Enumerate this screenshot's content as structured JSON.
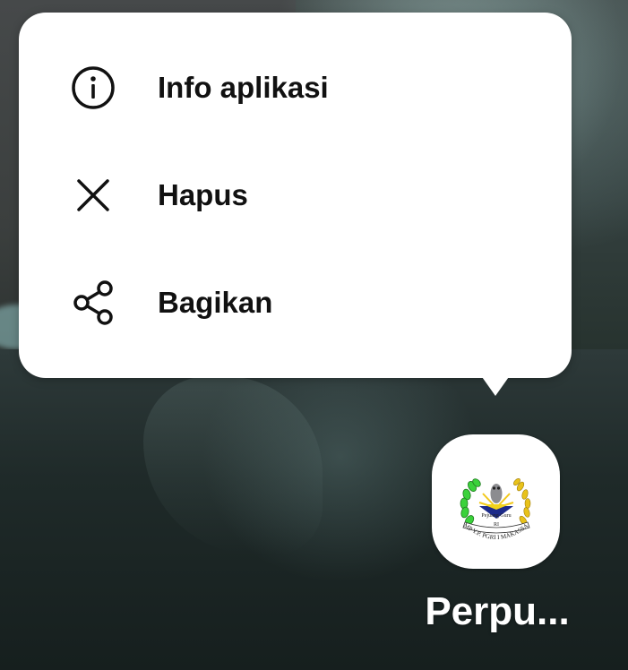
{
  "wallpaper": {
    "description_colors": {
      "sky": "#3f4746",
      "sea": "#1d2a2b"
    }
  },
  "context_menu": {
    "items": [
      {
        "label": "Info aplikasi",
        "icon": "info-icon"
      },
      {
        "label": "Hapus",
        "icon": "close-icon"
      },
      {
        "label": "Bagikan",
        "icon": "share-icon"
      }
    ],
    "background": "#ffffff",
    "text_color": "#111111"
  },
  "app": {
    "label": "Perpu...",
    "icon": "school-logo-icon",
    "logo_texts": {
      "banner": "Pejuang Guru",
      "country": "RI",
      "ring": "SMP Y.P. PGRI I MAKASSAR"
    }
  }
}
